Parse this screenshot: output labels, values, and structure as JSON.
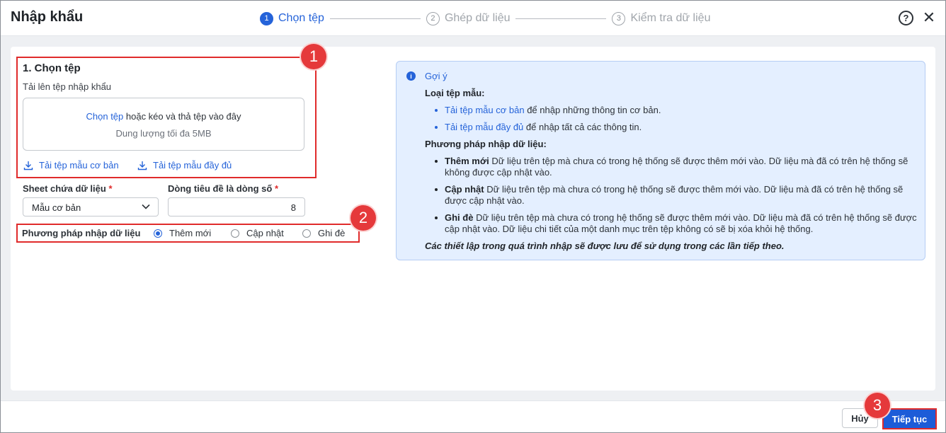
{
  "dialog": {
    "title": "Nhập khẩu",
    "steps": [
      {
        "num": "1",
        "label": "Chọn tệp"
      },
      {
        "num": "2",
        "label": "Ghép dữ liệu"
      },
      {
        "num": "3",
        "label": "Kiểm tra dữ liệu"
      }
    ],
    "active_step": 1,
    "help_icon": "question-circle-icon",
    "close_icon": "close-icon"
  },
  "annotations": [
    "1",
    "2",
    "3"
  ],
  "file_section": {
    "title": "1. Chọn tệp",
    "subtitle": "Tải lên tệp nhập khẩu",
    "dropzone_link": "Chọn tệp",
    "dropzone_text": " hoặc kéo và thả tệp vào đây",
    "dropzone_limit": "Dung lượng tối đa 5MB",
    "download_basic": "Tải tệp mẫu cơ bản",
    "download_full": "Tải tệp mẫu đầy đủ"
  },
  "fields": {
    "sheet_label": "Sheet chứa dữ liệu",
    "sheet_value": "Mẫu cơ bản",
    "header_row_label": "Dòng tiêu đề là dòng số",
    "header_row_value": "8",
    "required_mark": "*"
  },
  "method": {
    "label": "Phương pháp nhập dữ liệu",
    "options": [
      "Thêm mới",
      "Cập nhật",
      "Ghi đè"
    ],
    "selected": "Thêm mới"
  },
  "hint": {
    "title": "Gợi ý",
    "template_heading": "Loại tệp mẫu:",
    "template_items": [
      {
        "link": "Tải tệp mẫu cơ bản",
        "text": " để nhập những thông tin cơ bản."
      },
      {
        "link": "Tải tệp mẫu đầy đủ",
        "text": " để nhập tất cả các thông tin."
      }
    ],
    "method_heading": "Phương pháp nhập dữ liệu:",
    "method_items": [
      {
        "term": "Thêm mới",
        "text": " Dữ liệu trên tệp mà chưa có trong hệ thống sẽ được thêm mới vào. Dữ liệu mà đã có trên hệ thống sẽ không được cập nhật vào."
      },
      {
        "term": "Cập nhật",
        "text": " Dữ liệu trên tệp mà chưa có trong hệ thống sẽ được thêm mới vào. Dữ liệu mà đã có trên hệ thống sẽ được cập nhật vào."
      },
      {
        "term": "Ghi đè",
        "text": " Dữ liệu trên tệp mà chưa có trong hệ thống sẽ được thêm mới vào. Dữ liệu mà đã có trên hệ thống sẽ được cập nhật vào. Dữ liệu chi tiết của một danh mục trên tệp không có sẽ bị xóa khỏi hệ thống."
      }
    ],
    "note": "Các thiết lập trong quá trình nhập sẽ được lưu để sử dụng trong các lần tiếp theo."
  },
  "footer": {
    "cancel_label": "Hủy",
    "next_label": "Tiếp tục"
  },
  "colors": {
    "accent": "#2563d9",
    "annotation_red": "#e02b2b",
    "hint_bg": "#e4efff"
  }
}
